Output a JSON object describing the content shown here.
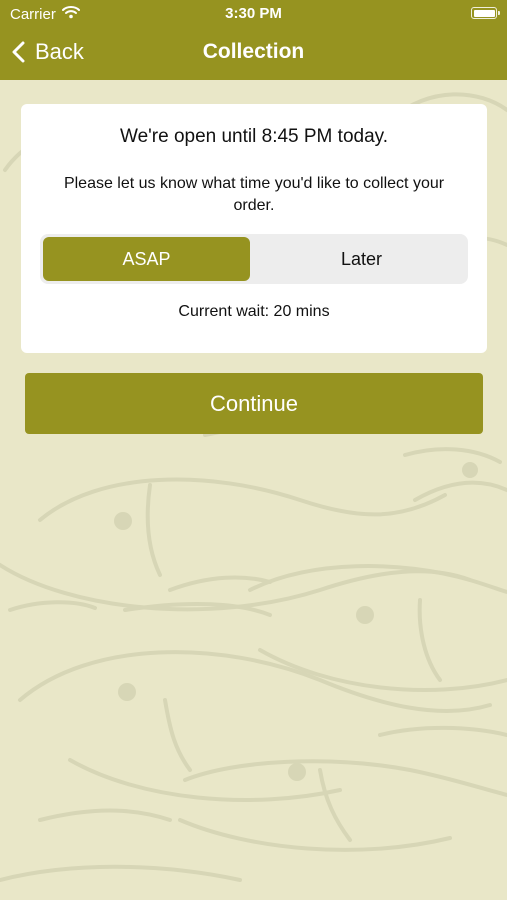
{
  "status_bar": {
    "carrier": "Carrier",
    "time": "3:30 PM"
  },
  "nav": {
    "back_label": "Back",
    "title": "Collection"
  },
  "collection": {
    "open_hours": "We're open until 8:45 PM today.",
    "instruction": "Please let us know what time you'd like to collect your order.",
    "options": [
      {
        "label": "ASAP",
        "selected": true
      },
      {
        "label": "Later",
        "selected": false
      }
    ],
    "current_wait": "Current wait: 20 mins"
  },
  "actions": {
    "continue_label": "Continue"
  },
  "icons": {
    "wifi": "wifi-icon",
    "battery": "battery-icon",
    "back": "chevron-left-icon",
    "background": "fish-pattern"
  },
  "colors": {
    "brand": "#969320",
    "background": "#e9e7c8",
    "card": "#ffffff",
    "segment_track": "#ededed",
    "text": "#111111"
  }
}
